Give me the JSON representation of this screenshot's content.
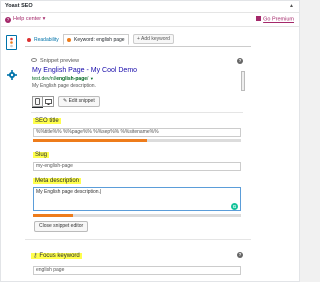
{
  "app": {
    "title": "Yoast SEO"
  },
  "helpbar": {
    "help_label": "Help center",
    "gopro_label": "Go Premium"
  },
  "tabs": [
    {
      "label": "Readability",
      "status_color": "#dc3232"
    },
    {
      "label": "Keyword: english page",
      "status_color": "#ee7c1b"
    }
  ],
  "add_keyword_label": "+ Add keyword",
  "snippet": {
    "section_label": "Snippet preview",
    "preview_title": "My English Page - My Cool Demo",
    "preview_url_prefix": "test.dev/nl/",
    "preview_url_slug": "english-page",
    "preview_url_suffix": "/",
    "preview_description": "My English page description.",
    "edit_button": "Edit snippet",
    "close_button": "Close snippet editor"
  },
  "fields": {
    "seo_title": {
      "label": "SEO title",
      "value": "%%title%% %%page%% %%sep%% %%sitename%%",
      "progress": 0.55
    },
    "slug": {
      "label": "Slug",
      "value": "my-english-page"
    },
    "meta_description": {
      "label": "Meta description",
      "value": "My English page description.",
      "progress": 0.19
    }
  },
  "focus_keyword": {
    "label": "Focus keyword",
    "value": "english page"
  },
  "colors": {
    "brand": "#a4286a",
    "link": "#0073aa",
    "progress_warn": "#ee7c1b",
    "highlight": "#ffff4d"
  }
}
